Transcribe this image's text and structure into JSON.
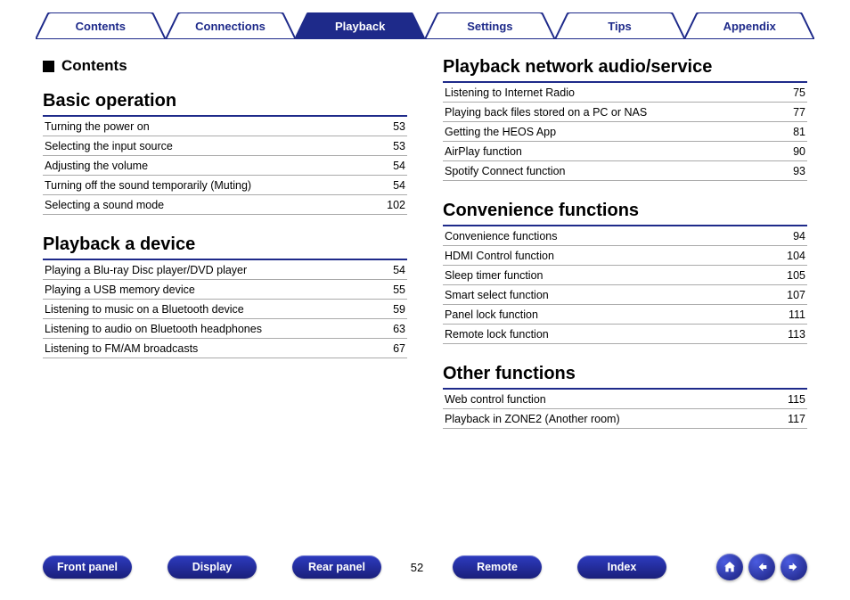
{
  "tabs": [
    {
      "label": "Contents",
      "active": false
    },
    {
      "label": "Connections",
      "active": false
    },
    {
      "label": "Playback",
      "active": true
    },
    {
      "label": "Settings",
      "active": false
    },
    {
      "label": "Tips",
      "active": false
    },
    {
      "label": "Appendix",
      "active": false
    }
  ],
  "contents_label": "Contents",
  "left_sections": [
    {
      "title": "Basic operation",
      "items": [
        {
          "title": "Turning the power on",
          "page": "53"
        },
        {
          "title": "Selecting the input source",
          "page": "53"
        },
        {
          "title": "Adjusting the volume",
          "page": "54"
        },
        {
          "title": "Turning off the sound temporarily (Muting)",
          "page": "54"
        },
        {
          "title": "Selecting a sound mode",
          "page": "102"
        }
      ]
    },
    {
      "title": "Playback a device",
      "items": [
        {
          "title": "Playing a Blu-ray Disc player/DVD player",
          "page": "54"
        },
        {
          "title": "Playing a USB memory device",
          "page": "55"
        },
        {
          "title": "Listening to music on a Bluetooth device",
          "page": "59"
        },
        {
          "title": "Listening to audio on Bluetooth headphones",
          "page": "63"
        },
        {
          "title": "Listening to FM/AM broadcasts",
          "page": "67"
        }
      ]
    }
  ],
  "right_sections": [
    {
      "title": "Playback network audio/service",
      "items": [
        {
          "title": "Listening to Internet Radio",
          "page": "75"
        },
        {
          "title": "Playing back files stored on a PC or NAS",
          "page": "77"
        },
        {
          "title": "Getting the HEOS App",
          "page": "81"
        },
        {
          "title": "AirPlay function",
          "page": "90"
        },
        {
          "title": "Spotify Connect function",
          "page": "93"
        }
      ]
    },
    {
      "title": "Convenience functions",
      "items": [
        {
          "title": "Convenience functions",
          "page": "94"
        },
        {
          "title": "HDMI Control function",
          "page": "104"
        },
        {
          "title": "Sleep timer function",
          "page": "105"
        },
        {
          "title": "Smart select function",
          "page": "107"
        },
        {
          "title": "Panel lock function",
          "page": "111"
        },
        {
          "title": "Remote lock function",
          "page": "113"
        }
      ]
    },
    {
      "title": "Other functions",
      "items": [
        {
          "title": "Web control function",
          "page": "115"
        },
        {
          "title": "Playback in ZONE2 (Another room)",
          "page": "117"
        }
      ]
    }
  ],
  "footer": {
    "buttons": [
      "Front panel",
      "Display",
      "Rear panel"
    ],
    "page_number": "52",
    "buttons2": [
      "Remote",
      "Index"
    ]
  }
}
